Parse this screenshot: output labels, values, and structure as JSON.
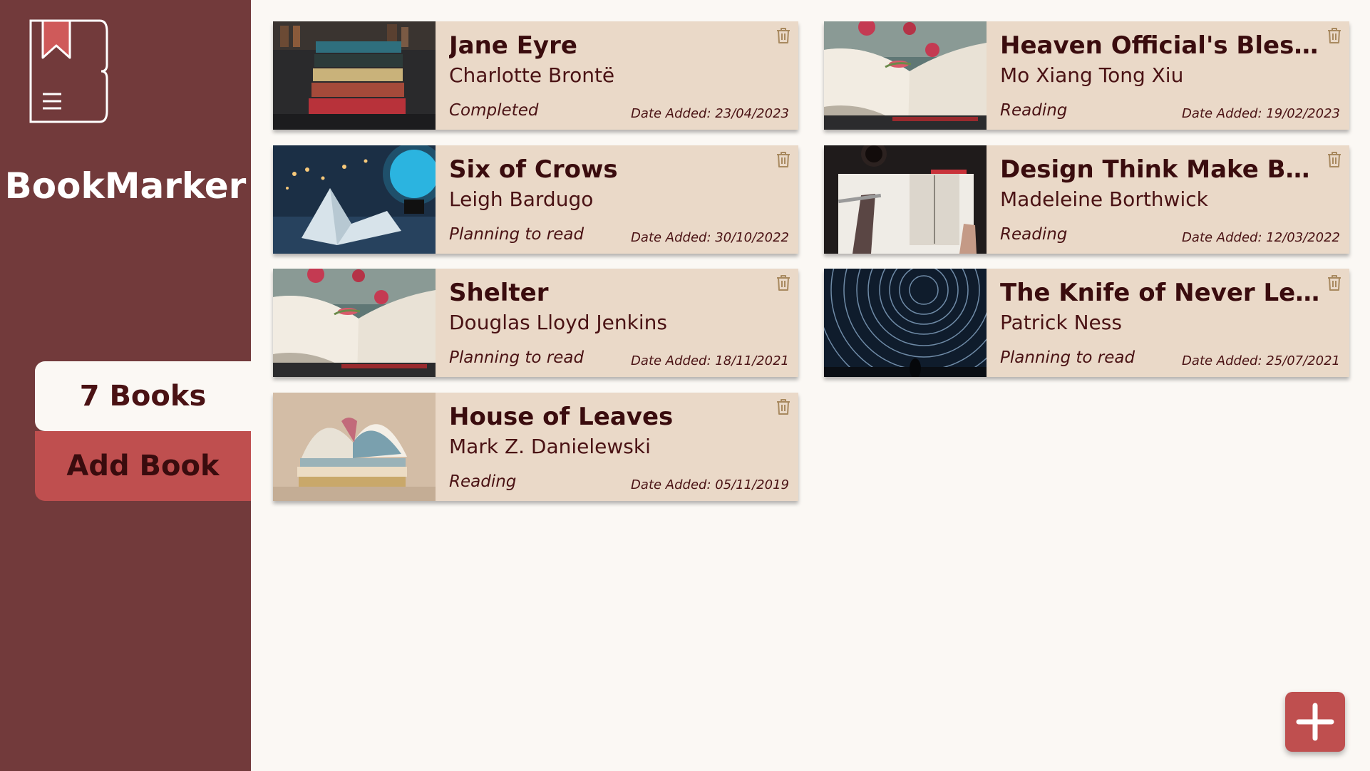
{
  "app": {
    "title": "BookMarker",
    "book_count_label": "7 Books",
    "add_book_label": "Add Book",
    "add_fab_icon": "plus-icon",
    "logo_icon": "bookmark-book-logo"
  },
  "colors": {
    "sidebar": "#723a3b",
    "accent": "#bf4f4f",
    "card": "#ead9c8",
    "background": "#fbf8f4",
    "text_dark": "#3a0c0e"
  },
  "books": [
    {
      "title": "Jane Eyre",
      "author": "Charlotte Brontë",
      "status": "Completed",
      "date_added": "Date Added: 23/04/2023",
      "cover": "stack-of-books-photo",
      "delete_icon": "trash-icon"
    },
    {
      "title": "Heaven Official's Blessing",
      "author": "Mo Xiang Tong Xiu",
      "status": "Reading",
      "date_added": "Date Added: 19/02/2023",
      "cover": "open-book-with-flowers-photo",
      "delete_icon": "trash-icon"
    },
    {
      "title": "Six of Crows",
      "author": "Leigh Bardugo",
      "status": "Planning to read",
      "date_added": "Date Added: 30/10/2022",
      "cover": "open-book-with-moon-lamp-photo",
      "delete_icon": "trash-icon"
    },
    {
      "title": "Design Think Make Break...",
      "author": "Madeleine Borthwick",
      "status": "Reading",
      "date_added": "Date Added: 12/03/2022",
      "cover": "hands-with-book-and-coffee-photo",
      "delete_icon": "trash-icon"
    },
    {
      "title": "Shelter",
      "author": "Douglas Lloyd Jenkins",
      "status": "Planning to read",
      "date_added": "Date Added: 18/11/2021",
      "cover": "open-book-with-flowers-photo",
      "delete_icon": "trash-icon"
    },
    {
      "title": "The Knife of Never Lettin...",
      "author": "Patrick Ness",
      "status": "Planning to read",
      "date_added": "Date Added: 25/07/2021",
      "cover": "star-trails-night-sky-photo",
      "delete_icon": "trash-icon"
    },
    {
      "title": "House of Leaves",
      "author": "Mark Z. Danielewski",
      "status": "Reading",
      "date_added": "Date Added: 05/11/2019",
      "cover": "open-book-on-stack-photo",
      "delete_icon": "trash-icon"
    }
  ]
}
